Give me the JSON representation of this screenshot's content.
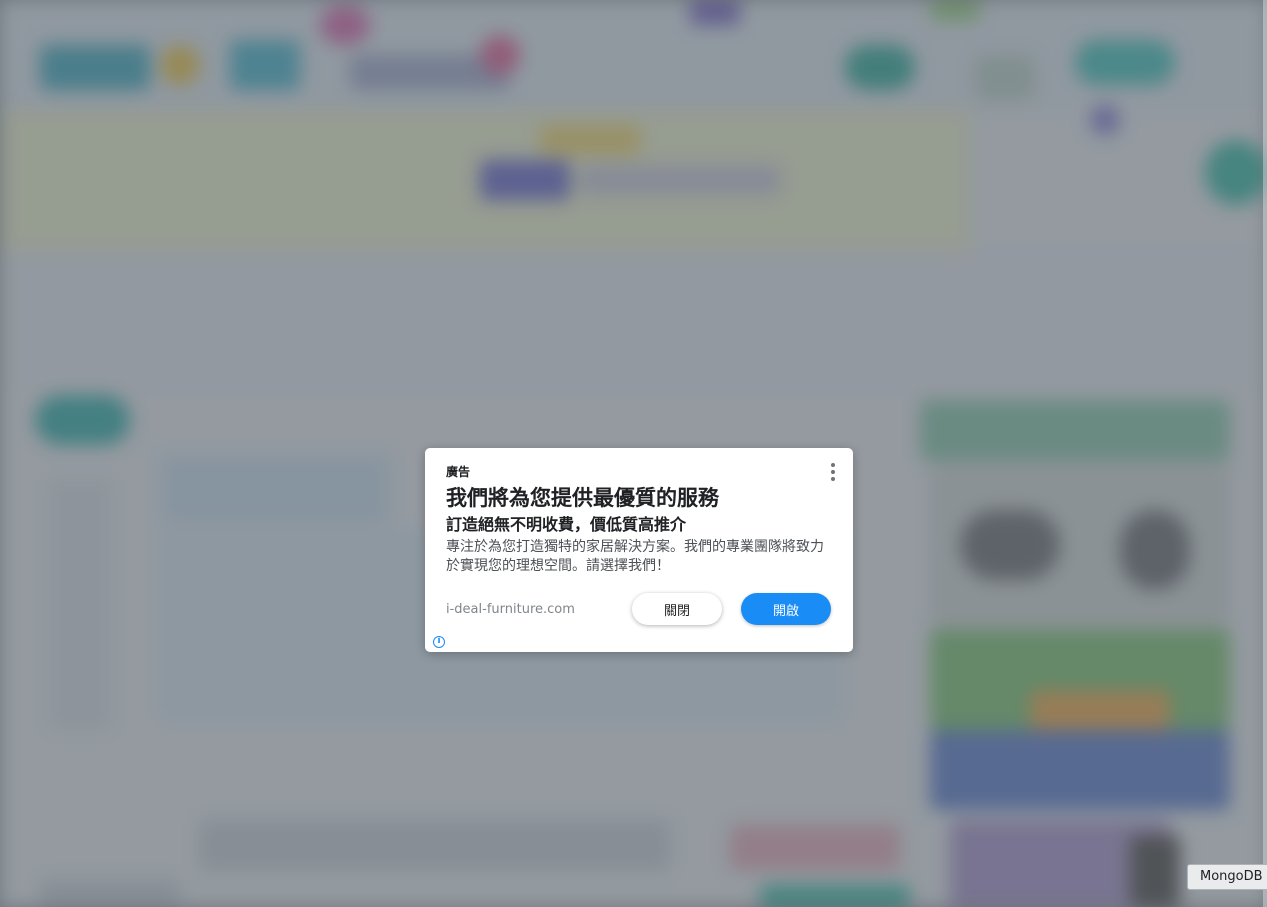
{
  "ad": {
    "label": "廣告",
    "headline": "我們將為您提供最優質的服務",
    "subheadline": "訂造絕無不明收費，價低質高推介",
    "body": "專注於為您打造獨特的家居解決方案。我們的專業團隊將致力於實現您的理想空間。請選擇我們！",
    "domain": "i-deal-furniture.com",
    "close_button": "關閉",
    "open_button": "開啟",
    "menu_icon": "more-vert-icon",
    "info_icon": "info-icon",
    "info_glyph": "i"
  },
  "tooltip": {
    "text": "MongoDB"
  },
  "colors": {
    "accent": "#1a8cf5",
    "overlay": "#5f6870",
    "card": "#ffffff",
    "text": "#202124",
    "muted": "#80868b"
  }
}
